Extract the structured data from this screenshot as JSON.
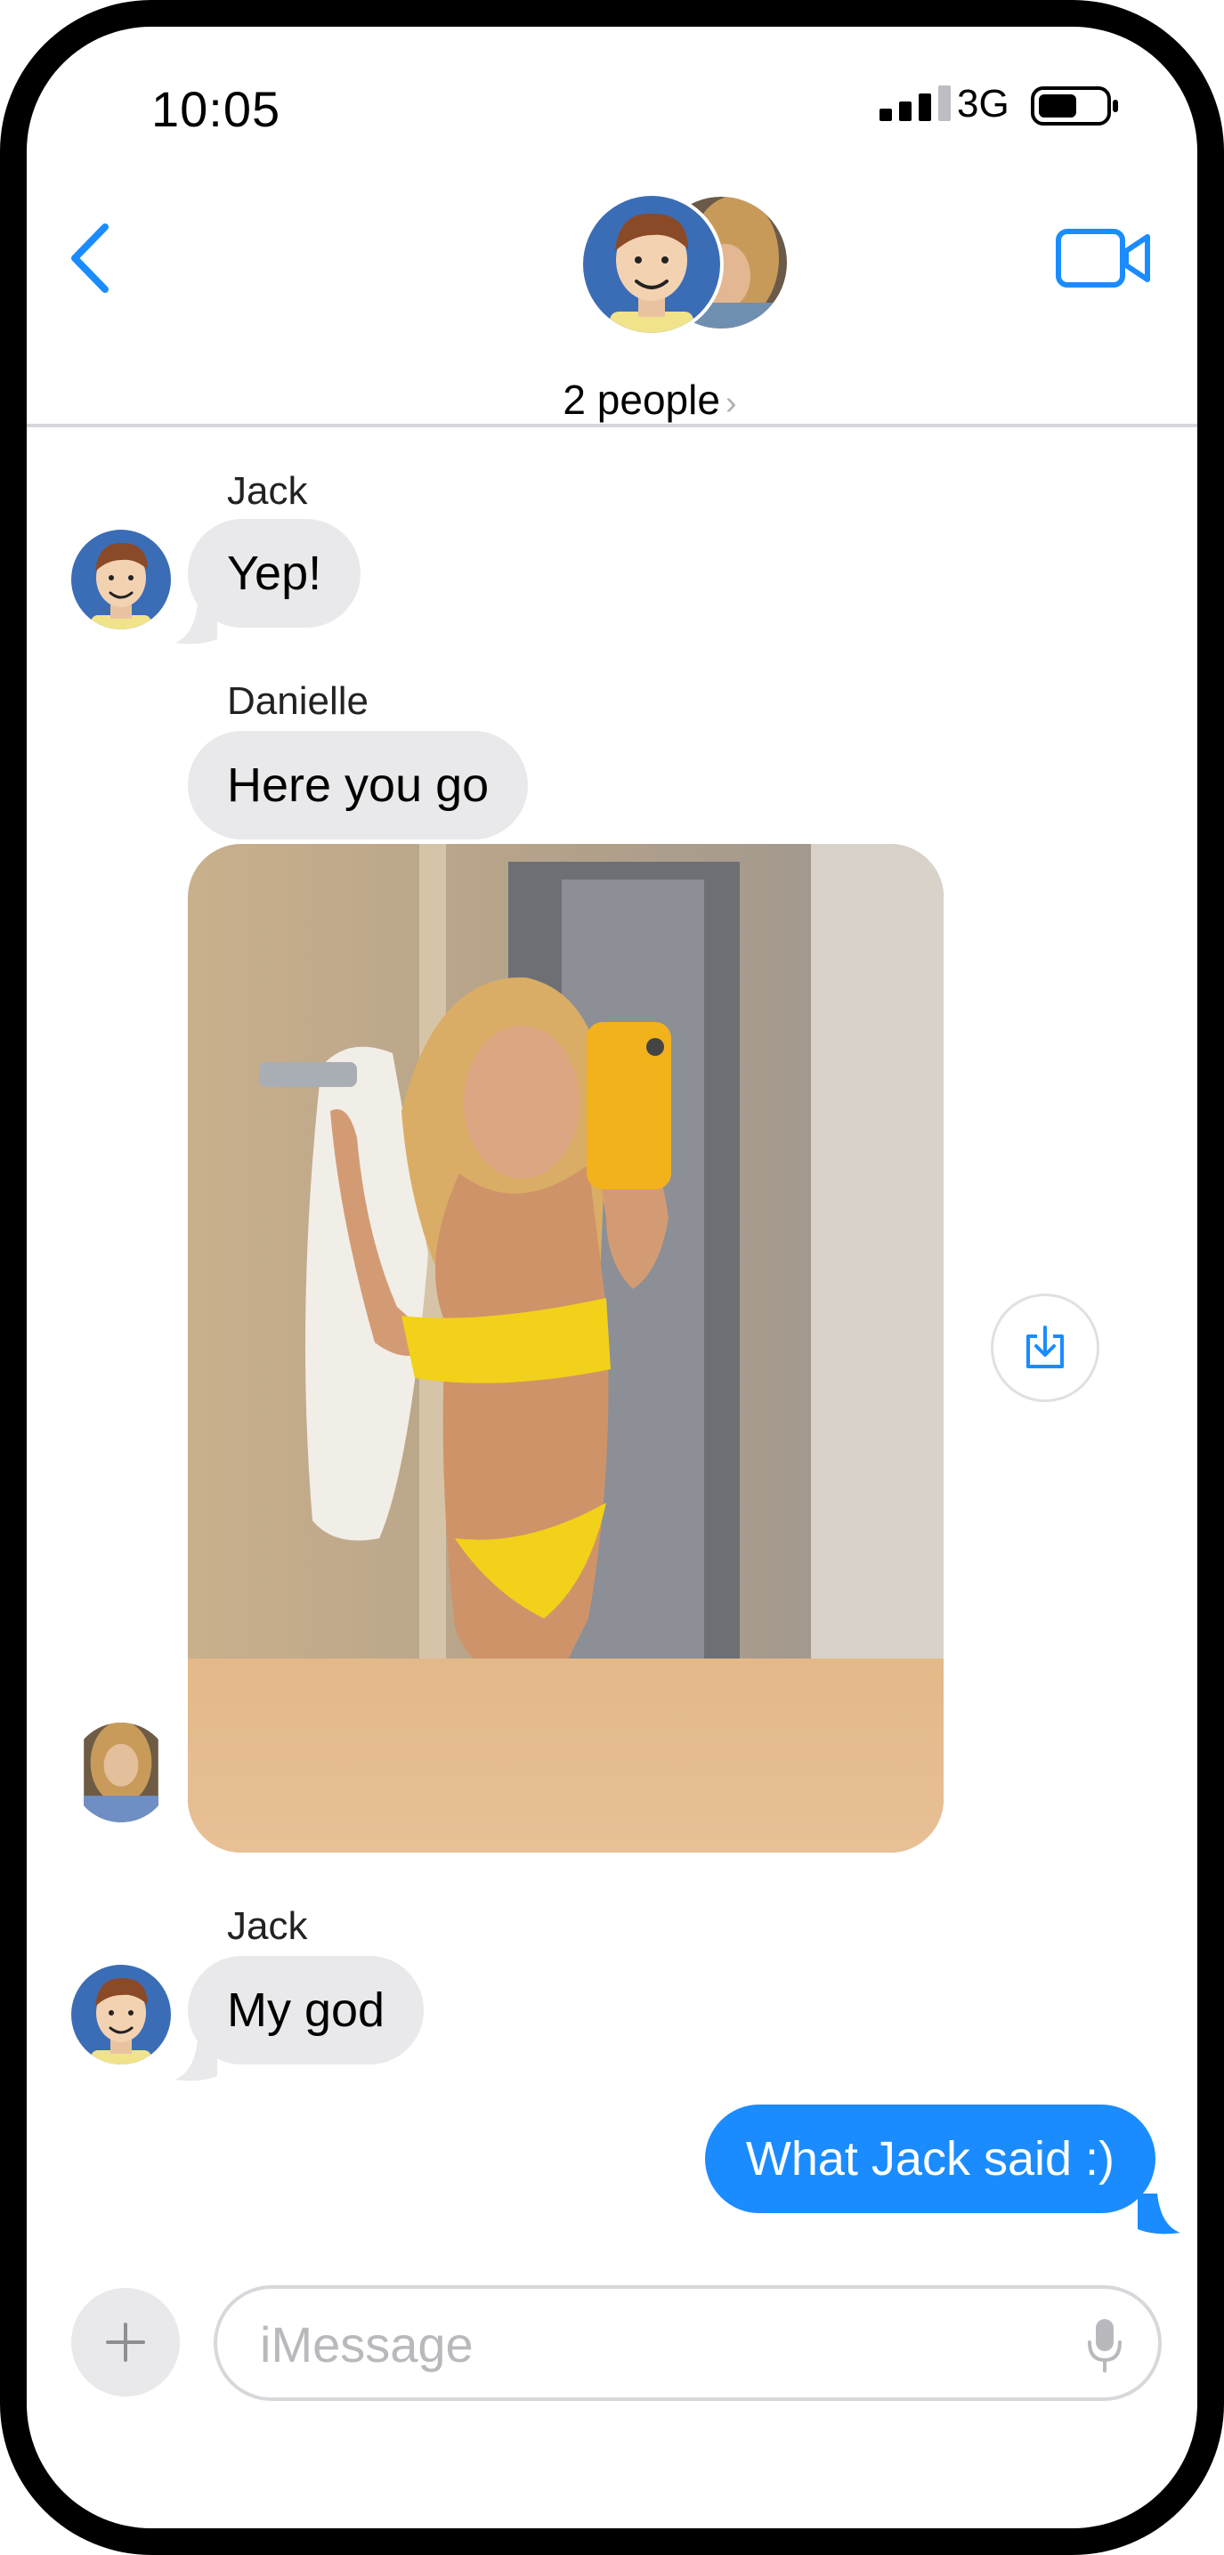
{
  "status_bar": {
    "time": "10:05",
    "network": "3G",
    "signal_bars": 4,
    "battery_level": 0.55
  },
  "header": {
    "participants_label": "2 people",
    "chevron": "›"
  },
  "colors": {
    "accent": "#1a8cff",
    "incoming_bubble": "#e9e9eb",
    "avatar_bg": "#3b6db6"
  },
  "messages": [
    {
      "sender": "Jack",
      "text": "Yep!"
    },
    {
      "sender": "Danielle",
      "text": "Here you go"
    },
    {
      "sender": "Jack",
      "text": "My god"
    },
    {
      "sender": "me",
      "text": "What Jack said :)"
    }
  ],
  "composer": {
    "placeholder": "iMessage"
  },
  "icons": [
    "back-chevron-icon",
    "video-camera-icon",
    "save-download-icon",
    "plus-icon",
    "microphone-icon"
  ]
}
